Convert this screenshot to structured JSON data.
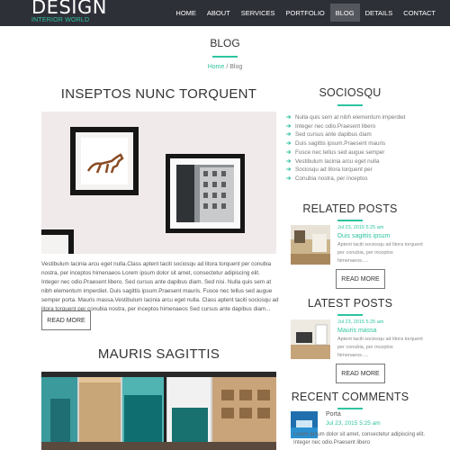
{
  "header": {
    "logo_main": "DESIGN",
    "logo_sub": "INTERIOR WORLD",
    "nav": [
      {
        "label": "HOME"
      },
      {
        "label": "ABOUT"
      },
      {
        "label": "SERVICES"
      },
      {
        "label": "PORTFOLIO"
      },
      {
        "label": "BLOG",
        "active": true
      },
      {
        "label": "DETAILS"
      },
      {
        "label": "CONTACT"
      }
    ]
  },
  "page": {
    "title": "BLOG",
    "breadcrumb": {
      "home": "Home",
      "separator": " / ",
      "current": "Blog"
    }
  },
  "posts": [
    {
      "title": "INSEPTOS NUNC TORQUENT",
      "excerpt": "Vestibulum lacinia arcu eget nulla.Class aptent taciti sociosqu ad litora torquent per conubia nostra, per inceptos himenaeos Lorem ipsum dolor sit amet, consectetur adipiscing elit. Integer nec odio.Praesent libero. Sed cursus ante dapibus diam. Sed nisi. Nulla quis sem at nibh elementum imperdiet. Duis sagittis ipsum.Praesent mauris. Fusce nec tellus sed augue semper porta. Mauris massa.Vestibulum lacinia arcu eget nulla. Class aptent taciti sociosqu ad litora torquent per conubia nostra, per inceptos himenaeos Sed cursus ante dapibus diam...",
      "read_more": "READ MORE"
    },
    {
      "title": "MAURIS SAGITTIS"
    }
  ],
  "sidebar": {
    "categories_title": "SOCIOSQU",
    "categories": [
      "Nulla quis sem at nibh elementum imperdiet",
      "Integer nec odio.Praesent libero",
      "Sed cursus ante dapibus diam",
      "Duis sagittis ipsum.Praesent mauris",
      "Fusce nec tellus sed augue semper",
      "Vestibulum lacinia arcu eget nulla",
      "Sociosqu ad litora torquent per",
      "Conubia nostra, per inceptos"
    ],
    "related_title": "RELATED POSTS",
    "related": {
      "date": "Jul 23, 2015 5:25 am",
      "title": "Duis sagittis ipsum",
      "text": "Aptent taciti sociosqu ad litora torquent per conubia, per inceptos himenaeos.....",
      "read_more": "READ MORE"
    },
    "latest_title": "LATEST POSTS",
    "latest": {
      "date": "Jul 23, 2015 5:25 am",
      "title": "Mauris massa",
      "text": "Aptent taciti sociosqu ad litora torquent per conubia, per inceptos himenaeos.....",
      "read_more": "READ MORE"
    },
    "comments_title": "RECENT COMMENTS",
    "comment": {
      "author": "Porta",
      "date": "Jul 23, 2015 5:25 am",
      "text": "Lorem ipsum dolor sit amet, consectetur adipiscing elit. Integer nec odio.Praesent libero"
    }
  },
  "colors": {
    "accent": "#2ec4a0",
    "header_bg": "#2e3038"
  }
}
